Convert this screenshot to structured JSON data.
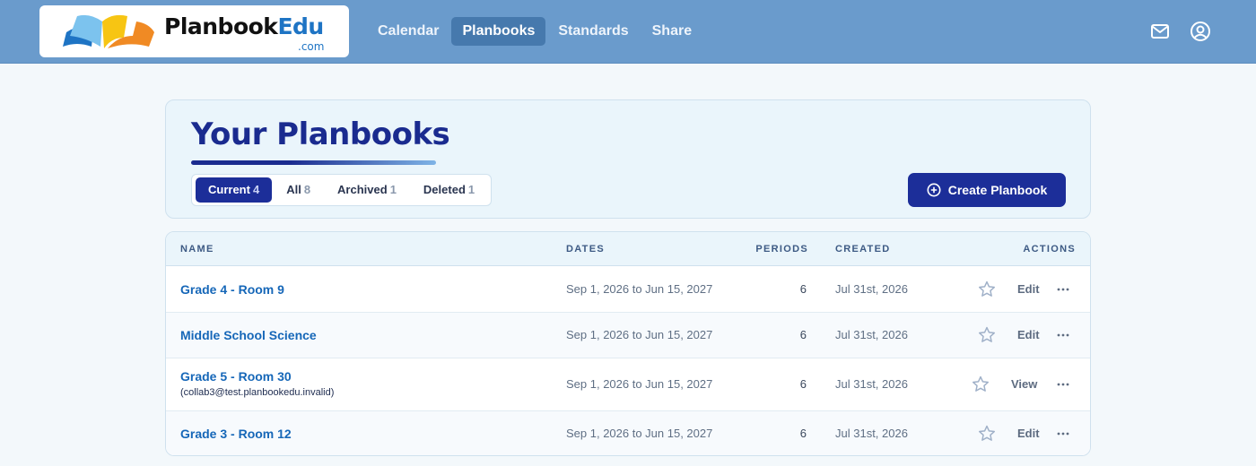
{
  "brand": {
    "name_part1": "Planbook",
    "name_part2": "Edu",
    "domain_suffix": ".com",
    "colors": {
      "blue": "#1e74c4",
      "dark": "#111111",
      "orange": "#f08a24",
      "yellow": "#f7c513",
      "light_blue": "#7cc3ee"
    }
  },
  "nav": {
    "items": [
      {
        "label": "Calendar",
        "active": false
      },
      {
        "label": "Planbooks",
        "active": true
      },
      {
        "label": "Standards",
        "active": false
      },
      {
        "label": "Share",
        "active": false
      }
    ]
  },
  "header_icons": {
    "mail": "mail-icon",
    "account": "account-circle-icon"
  },
  "page": {
    "title": "Your Planbooks",
    "filters": [
      {
        "label": "Current",
        "count": "4",
        "active": true
      },
      {
        "label": "All",
        "count": "8",
        "active": false
      },
      {
        "label": "Archived",
        "count": "1",
        "active": false
      },
      {
        "label": "Deleted",
        "count": "1",
        "active": false
      }
    ],
    "create_button": {
      "label": "Create Planbook",
      "icon": "plus-circle-icon"
    }
  },
  "table": {
    "columns": {
      "name": "NAME",
      "dates": "DATES",
      "periods": "PERIODS",
      "created": "CREATED",
      "actions": "ACTIONS"
    },
    "rows": [
      {
        "name": "Grade 4 - Room 9",
        "owner": "",
        "dates": "Sep 1, 2026 to Jun 15, 2027",
        "periods": "6",
        "created": "Jul 31st, 2026",
        "action": "Edit"
      },
      {
        "name": "Middle School Science",
        "owner": "",
        "dates": "Sep 1, 2026 to Jun 15, 2027",
        "periods": "6",
        "created": "Jul 31st, 2026",
        "action": "Edit"
      },
      {
        "name": "Grade 5 - Room 30",
        "owner": "(collab3@test.planbookedu.invalid)",
        "dates": "Sep 1, 2026 to Jun 15, 2027",
        "periods": "6",
        "created": "Jul 31st, 2026",
        "action": "View"
      },
      {
        "name": "Grade 3 - Room 12",
        "owner": "",
        "dates": "Sep 1, 2026 to Jun 15, 2027",
        "periods": "6",
        "created": "Jul 31st, 2026",
        "action": "Edit"
      }
    ]
  },
  "colors": {
    "topbar": "#6a9bcc",
    "primary": "#1c2e99",
    "link": "#1667b8",
    "background": "#f3f8fb"
  }
}
